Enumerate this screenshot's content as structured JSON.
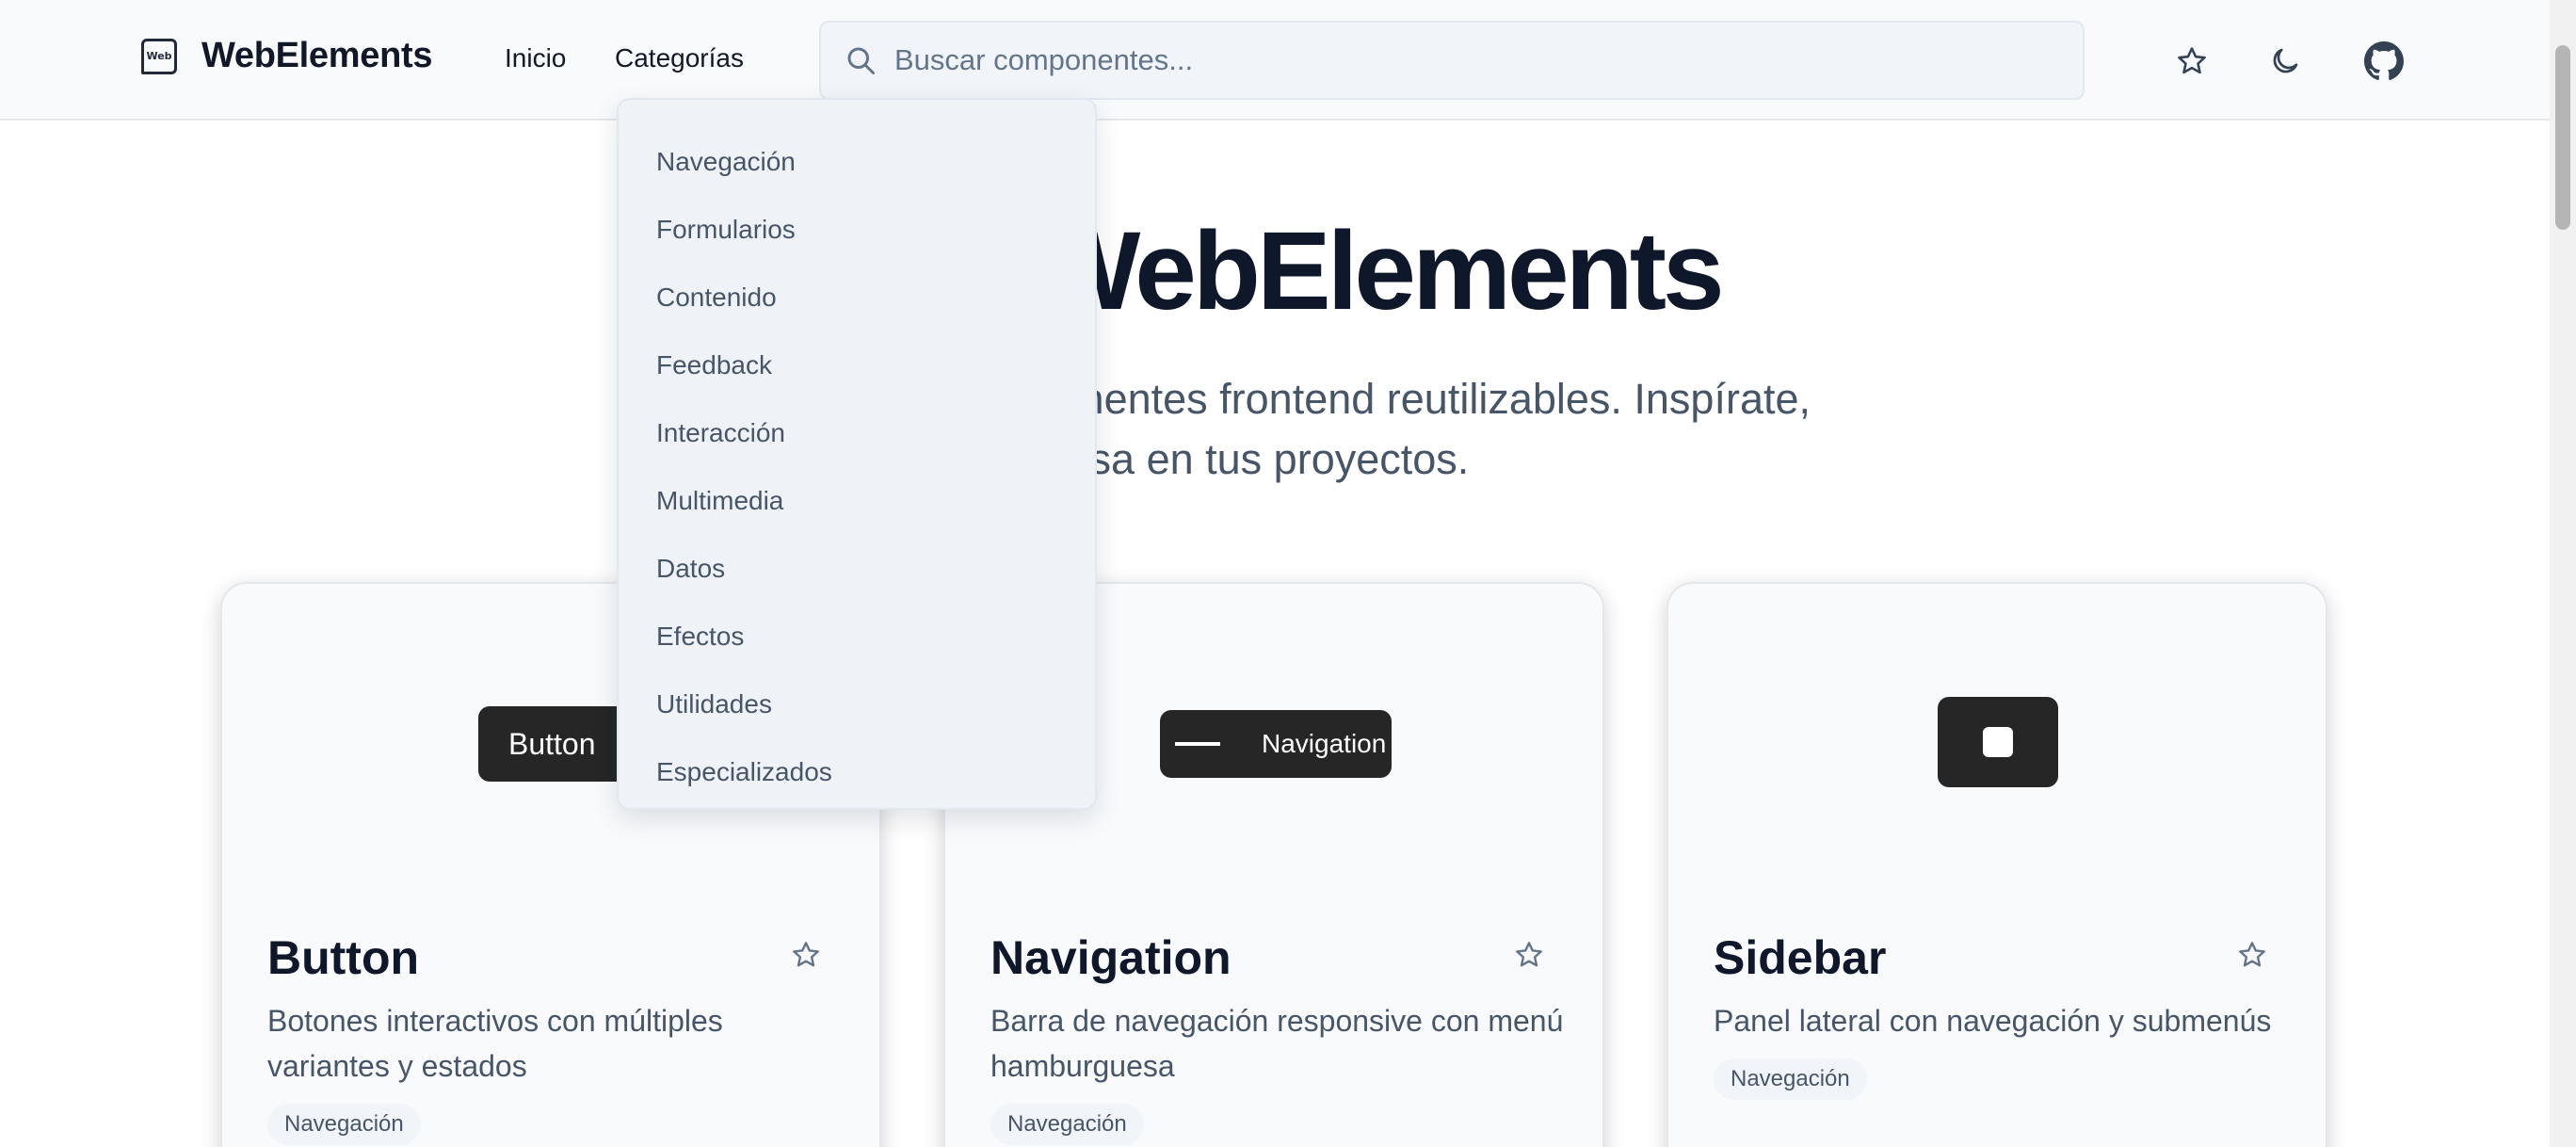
{
  "header": {
    "brand_logo_text": "Web",
    "brand_name": "WebElements",
    "nav": {
      "home": "Inicio",
      "categories": "Categorías"
    },
    "search": {
      "placeholder": "Buscar componentes...",
      "value": ""
    },
    "icons": [
      "star-icon",
      "moon-icon",
      "github-icon"
    ]
  },
  "dropdown": {
    "items": [
      "Navegación",
      "Formularios",
      "Contenido",
      "Feedback",
      "Interacción",
      "Multimedia",
      "Datos",
      "Efectos",
      "Utilidades",
      "Especializados"
    ]
  },
  "hero": {
    "title": "WebElements",
    "subtitle_line1": "mponentes frontend reutilizables. Inspírate,",
    "subtitle_line2": "a y usa en tus proyectos."
  },
  "cards": [
    {
      "title": "Button",
      "description": "Botones interactivos con múltiples variantes y estados",
      "tag": "Navegación",
      "preview_label": "Button"
    },
    {
      "title": "Navigation",
      "description": "Barra de navegación responsive con menú hamburguesa",
      "tag": "Navegación",
      "preview_label": "Navigation"
    },
    {
      "title": "Sidebar",
      "description": "Panel lateral con navegación y submenús",
      "tag": "Navegación",
      "preview_label": ""
    }
  ],
  "colors": {
    "header_bg": "#f8fafc",
    "text_primary": "#0f172a",
    "text_muted": "#475569",
    "preview_dark": "#262626",
    "dropdown_bg": "#eff3f8"
  }
}
